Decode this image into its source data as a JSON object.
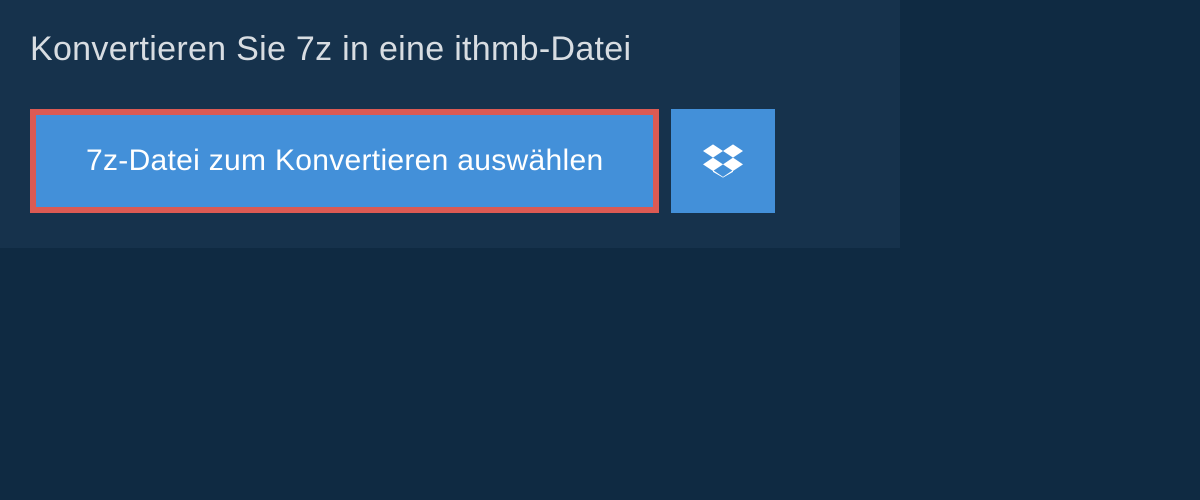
{
  "header": {
    "title": "Konvertieren Sie 7z in eine ithmb-Datei"
  },
  "actions": {
    "select_file_label": "7z-Datei zum Konvertieren auswählen",
    "dropbox_icon": "dropbox"
  },
  "colors": {
    "page_bg": "#0f2a42",
    "panel_bg": "#16324c",
    "button_bg": "#4390d9",
    "highlight_border": "#db5a53"
  }
}
